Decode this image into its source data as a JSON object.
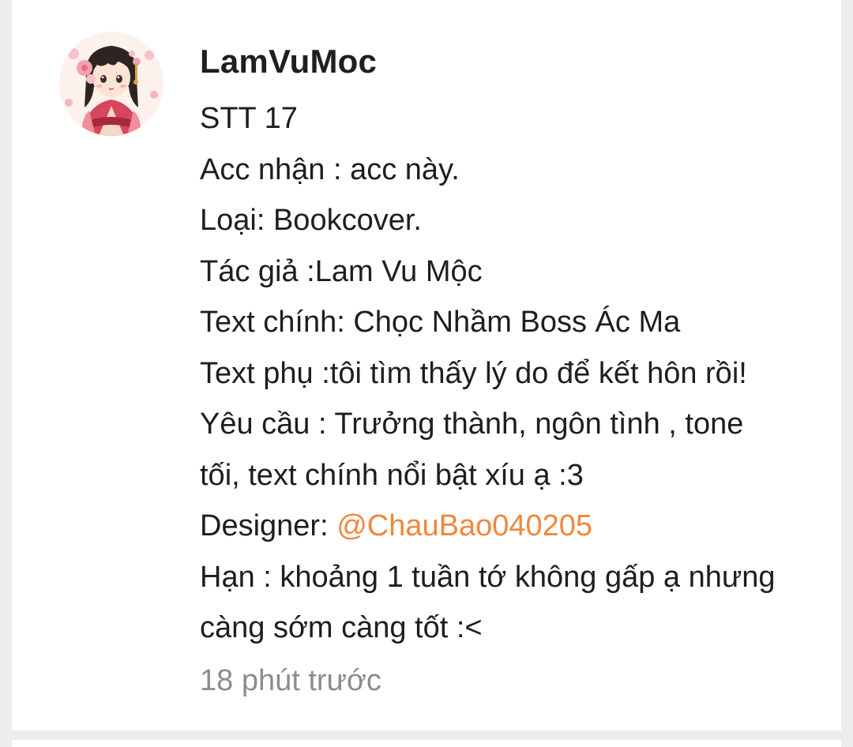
{
  "comment": {
    "username": "LamVuMoc",
    "lines": [
      "STT 17",
      "Acc nhận : acc này.",
      "Loại: Bookcover.",
      "Tác giả :Lam Vu Mộc",
      "Text chính: Chọc Nhầm Boss Ác Ma",
      "Text phụ :tôi tìm thấy lý do để kết hôn rồi!",
      "Yêu cầu : Trưởng thành, ngôn tình , tone",
      "tối, text chính nổi bật xíu ạ :3"
    ],
    "designer_label": "Designer: ",
    "designer_mention": "@ChauBao040205",
    "deadline_lines": [
      "Hạn : khoảng 1 tuần tớ không gấp ạ nhưng",
      "càng sớm càng tốt :<"
    ],
    "timestamp": "18 phút trước"
  },
  "colors": {
    "mention": "#f0873d",
    "text": "#1e1e1e",
    "timestamp": "#8c8c8c",
    "background": "#ececec",
    "card": "#ffffff"
  },
  "icons": {
    "avatar": "anime-girl-avatar"
  }
}
